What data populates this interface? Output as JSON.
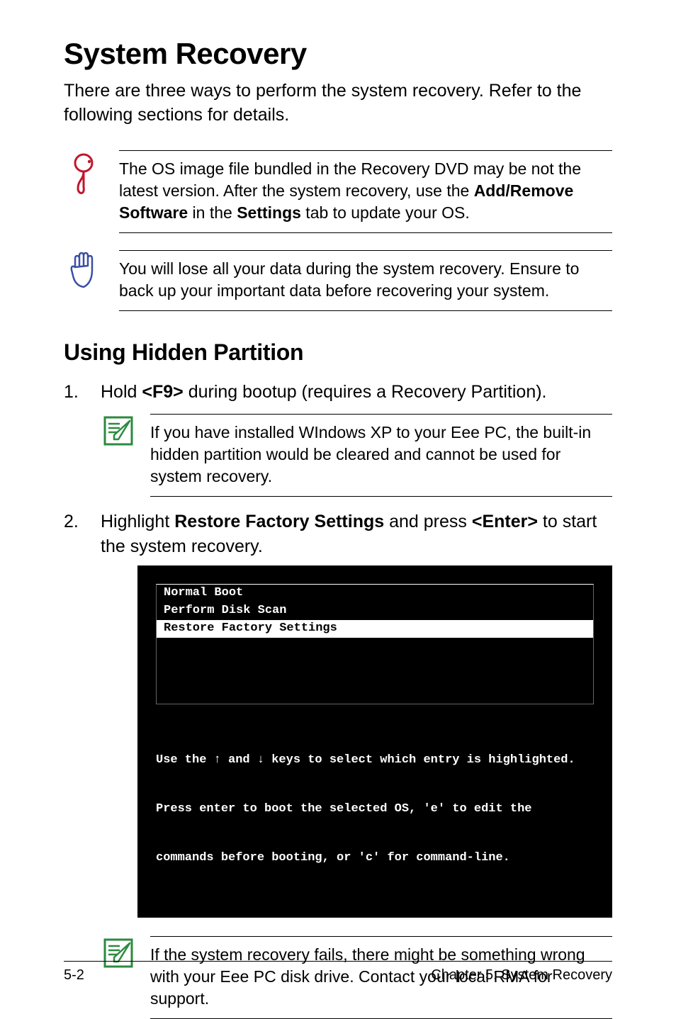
{
  "title": "System Recovery",
  "intro": "There are three ways to perform the system recovery. Refer to the following sections for details.",
  "callout1": {
    "pre": "The OS image file bundled in the Recovery DVD may be not the latest version. After the system recovery, use the ",
    "b1": "Add/Remove Software",
    "mid1": " in the ",
    "b2": "Settings",
    "post": " tab to update your OS."
  },
  "callout2": "You will lose all your data during the system recovery. Ensure to back up your important data before recovering your system.",
  "section_heading": "Using Hidden Partition",
  "step1": {
    "pre": "Hold ",
    "b1": "<F9>",
    "post": " during bootup (requires a Recovery Partition)."
  },
  "step1_note": "If you have installed WIndows XP to your Eee PC, the built-in hidden partition would be cleared and cannot be used for system recovery.",
  "step2": {
    "pre": "Highlight ",
    "b1": "Restore Factory Settings",
    "mid": " and press ",
    "b2": "<Enter>",
    "post": " to start the system recovery."
  },
  "terminal": {
    "rows": {
      "r0": "Normal Boot",
      "r1": "Perform Disk Scan",
      "r2": "Restore Factory Settings"
    },
    "hint_l1": "Use the ↑ and ↓ keys to select which entry is highlighted.",
    "hint_l2": "Press enter to boot the selected OS, 'e' to edit the",
    "hint_l3": "commands before booting, or 'c' for command-line."
  },
  "callout3": "If the system recovery fails, there might be something wrong with your Eee PC disk drive. Contact your local RMA for support.",
  "footer_left": "5-2",
  "footer_right": "Chapter 5: System Recovery"
}
